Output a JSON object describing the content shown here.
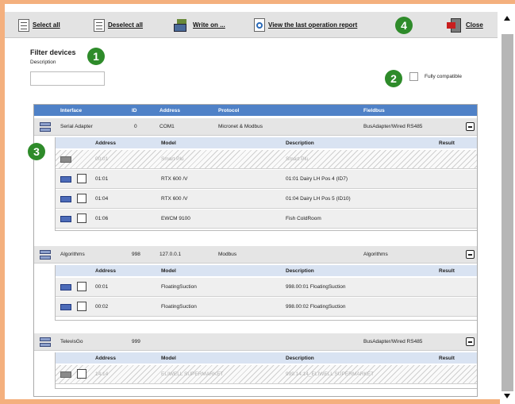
{
  "toolbar": {
    "select_all": "Select all",
    "deselect_all": "Deselect all",
    "write_on": "Write on ...",
    "view_report": "View the last operation report",
    "close": "Close"
  },
  "filter": {
    "title": "Filter devices",
    "description_label": "Description",
    "description_value": "",
    "fully_compatible_label": "Fully compatible",
    "fully_compatible_checked": false
  },
  "badges": [
    "1",
    "2",
    "3",
    "4"
  ],
  "grid": {
    "columns": [
      "Interface",
      "ID",
      "Address",
      "Protocol",
      "Fieldbus"
    ],
    "sub_columns": [
      "Address",
      "Model",
      "Description",
      "Result"
    ],
    "devices": [
      {
        "interface": "Serial Adapter",
        "id": "0",
        "address": "COM1",
        "protocol": "Micronet & Modbus",
        "fieldbus": "BusAdapter/Wired RS485",
        "rows": [
          {
            "address": "00:01",
            "model": "Smart Plu",
            "description": "Smart Plu",
            "result": "",
            "disabled": true
          },
          {
            "address": "01:01",
            "model": "RTX 600 /V",
            "description": "01:01 Dairy LH Pos 4 (ID7)",
            "result": "",
            "disabled": false
          },
          {
            "address": "01:04",
            "model": "RTX 600 /V",
            "description": "01:04 Dairy LH Pos 5 (ID10)",
            "result": "",
            "disabled": false
          },
          {
            "address": "01:06",
            "model": "EWCM 9100",
            "description": "Fish ColdRoom",
            "result": "",
            "disabled": false
          }
        ]
      },
      {
        "interface": "Algorithms",
        "id": "998",
        "address": "127.0.0.1",
        "protocol": "Modbus",
        "fieldbus": "Algorithms",
        "rows": [
          {
            "address": "00:01",
            "model": "FloatingSuction",
            "description": "998.00:01 FloatingSuction",
            "result": "",
            "disabled": false
          },
          {
            "address": "00:02",
            "model": "FloatingSuction",
            "description": "998.00:02 FloatingSuction",
            "result": "",
            "disabled": false
          }
        ]
      },
      {
        "interface": "TelevisGo",
        "id": "999",
        "address": "",
        "protocol": "",
        "fieldbus": "BusAdapter/Wired RS485",
        "rows": [
          {
            "address": "14:14",
            "model": "ELIWELL SUPERMARKET",
            "description": "999.14:14_ELIWELL SUPERMARKET",
            "result": "",
            "disabled": true
          }
        ]
      }
    ]
  },
  "colors": {
    "frame": "#f4b07e",
    "header": "#4f81c7",
    "badge": "#2e8b2a"
  }
}
